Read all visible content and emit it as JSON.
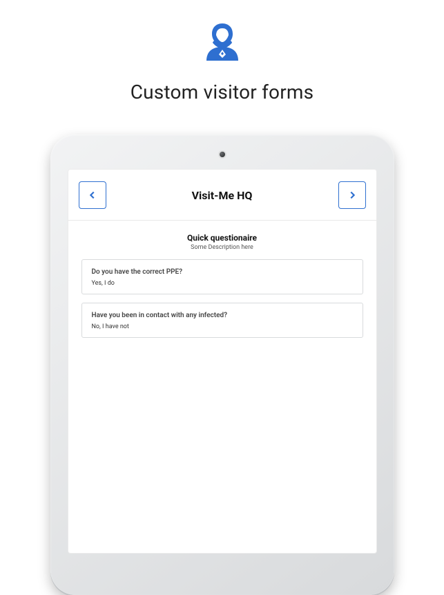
{
  "hero": {
    "title": "Custom visitor forms"
  },
  "app": {
    "title": "Visit-Me HQ",
    "section": {
      "title": "Quick questionaire",
      "description": "Some Description here"
    },
    "questions": [
      {
        "question": "Do you have the correct PPE?",
        "answer": "Yes, I do"
      },
      {
        "question": "Have you been in contact with any infected?",
        "answer": "No, I have not"
      }
    ]
  },
  "colors": {
    "accent": "#2e6fd0"
  }
}
